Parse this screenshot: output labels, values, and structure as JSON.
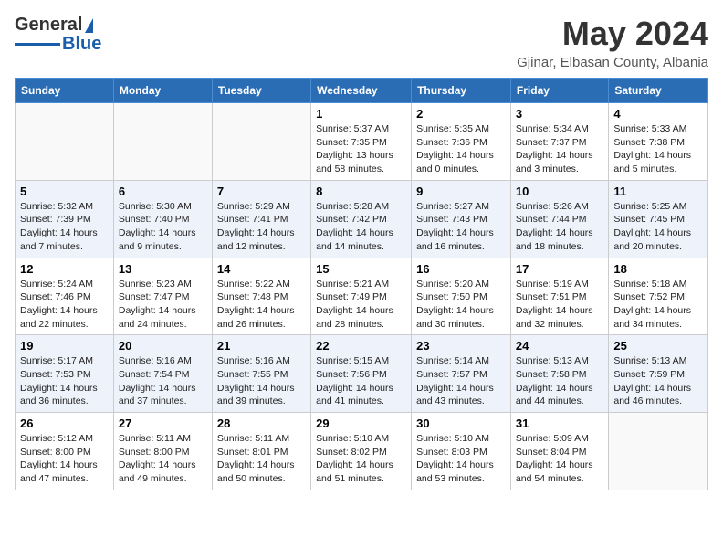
{
  "logo": {
    "general": "General",
    "blue": "Blue"
  },
  "title": "May 2024",
  "location": "Gjinar, Elbasan County, Albania",
  "days_of_week": [
    "Sunday",
    "Monday",
    "Tuesday",
    "Wednesday",
    "Thursday",
    "Friday",
    "Saturday"
  ],
  "weeks": [
    [
      {
        "day": "",
        "info": ""
      },
      {
        "day": "",
        "info": ""
      },
      {
        "day": "",
        "info": ""
      },
      {
        "day": "1",
        "info": "Sunrise: 5:37 AM\nSunset: 7:35 PM\nDaylight: 13 hours\nand 58 minutes."
      },
      {
        "day": "2",
        "info": "Sunrise: 5:35 AM\nSunset: 7:36 PM\nDaylight: 14 hours\nand 0 minutes."
      },
      {
        "day": "3",
        "info": "Sunrise: 5:34 AM\nSunset: 7:37 PM\nDaylight: 14 hours\nand 3 minutes."
      },
      {
        "day": "4",
        "info": "Sunrise: 5:33 AM\nSunset: 7:38 PM\nDaylight: 14 hours\nand 5 minutes."
      }
    ],
    [
      {
        "day": "5",
        "info": "Sunrise: 5:32 AM\nSunset: 7:39 PM\nDaylight: 14 hours\nand 7 minutes."
      },
      {
        "day": "6",
        "info": "Sunrise: 5:30 AM\nSunset: 7:40 PM\nDaylight: 14 hours\nand 9 minutes."
      },
      {
        "day": "7",
        "info": "Sunrise: 5:29 AM\nSunset: 7:41 PM\nDaylight: 14 hours\nand 12 minutes."
      },
      {
        "day": "8",
        "info": "Sunrise: 5:28 AM\nSunset: 7:42 PM\nDaylight: 14 hours\nand 14 minutes."
      },
      {
        "day": "9",
        "info": "Sunrise: 5:27 AM\nSunset: 7:43 PM\nDaylight: 14 hours\nand 16 minutes."
      },
      {
        "day": "10",
        "info": "Sunrise: 5:26 AM\nSunset: 7:44 PM\nDaylight: 14 hours\nand 18 minutes."
      },
      {
        "day": "11",
        "info": "Sunrise: 5:25 AM\nSunset: 7:45 PM\nDaylight: 14 hours\nand 20 minutes."
      }
    ],
    [
      {
        "day": "12",
        "info": "Sunrise: 5:24 AM\nSunset: 7:46 PM\nDaylight: 14 hours\nand 22 minutes."
      },
      {
        "day": "13",
        "info": "Sunrise: 5:23 AM\nSunset: 7:47 PM\nDaylight: 14 hours\nand 24 minutes."
      },
      {
        "day": "14",
        "info": "Sunrise: 5:22 AM\nSunset: 7:48 PM\nDaylight: 14 hours\nand 26 minutes."
      },
      {
        "day": "15",
        "info": "Sunrise: 5:21 AM\nSunset: 7:49 PM\nDaylight: 14 hours\nand 28 minutes."
      },
      {
        "day": "16",
        "info": "Sunrise: 5:20 AM\nSunset: 7:50 PM\nDaylight: 14 hours\nand 30 minutes."
      },
      {
        "day": "17",
        "info": "Sunrise: 5:19 AM\nSunset: 7:51 PM\nDaylight: 14 hours\nand 32 minutes."
      },
      {
        "day": "18",
        "info": "Sunrise: 5:18 AM\nSunset: 7:52 PM\nDaylight: 14 hours\nand 34 minutes."
      }
    ],
    [
      {
        "day": "19",
        "info": "Sunrise: 5:17 AM\nSunset: 7:53 PM\nDaylight: 14 hours\nand 36 minutes."
      },
      {
        "day": "20",
        "info": "Sunrise: 5:16 AM\nSunset: 7:54 PM\nDaylight: 14 hours\nand 37 minutes."
      },
      {
        "day": "21",
        "info": "Sunrise: 5:16 AM\nSunset: 7:55 PM\nDaylight: 14 hours\nand 39 minutes."
      },
      {
        "day": "22",
        "info": "Sunrise: 5:15 AM\nSunset: 7:56 PM\nDaylight: 14 hours\nand 41 minutes."
      },
      {
        "day": "23",
        "info": "Sunrise: 5:14 AM\nSunset: 7:57 PM\nDaylight: 14 hours\nand 43 minutes."
      },
      {
        "day": "24",
        "info": "Sunrise: 5:13 AM\nSunset: 7:58 PM\nDaylight: 14 hours\nand 44 minutes."
      },
      {
        "day": "25",
        "info": "Sunrise: 5:13 AM\nSunset: 7:59 PM\nDaylight: 14 hours\nand 46 minutes."
      }
    ],
    [
      {
        "day": "26",
        "info": "Sunrise: 5:12 AM\nSunset: 8:00 PM\nDaylight: 14 hours\nand 47 minutes."
      },
      {
        "day": "27",
        "info": "Sunrise: 5:11 AM\nSunset: 8:00 PM\nDaylight: 14 hours\nand 49 minutes."
      },
      {
        "day": "28",
        "info": "Sunrise: 5:11 AM\nSunset: 8:01 PM\nDaylight: 14 hours\nand 50 minutes."
      },
      {
        "day": "29",
        "info": "Sunrise: 5:10 AM\nSunset: 8:02 PM\nDaylight: 14 hours\nand 51 minutes."
      },
      {
        "day": "30",
        "info": "Sunrise: 5:10 AM\nSunset: 8:03 PM\nDaylight: 14 hours\nand 53 minutes."
      },
      {
        "day": "31",
        "info": "Sunrise: 5:09 AM\nSunset: 8:04 PM\nDaylight: 14 hours\nand 54 minutes."
      },
      {
        "day": "",
        "info": ""
      }
    ]
  ]
}
